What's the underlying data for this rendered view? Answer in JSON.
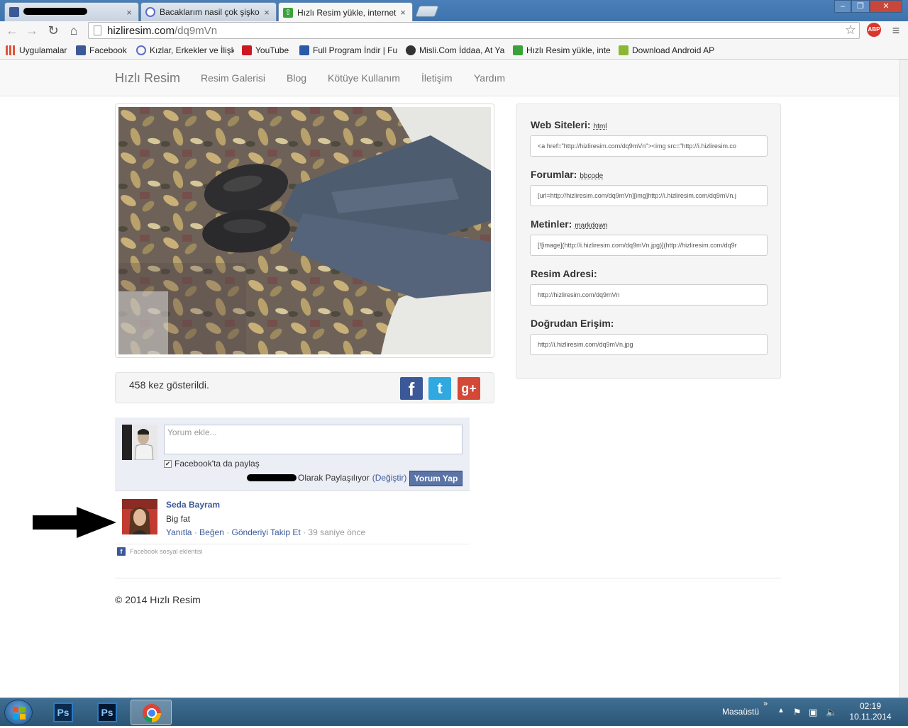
{
  "browser": {
    "tabs": [
      {
        "title": "",
        "active": false
      },
      {
        "title": "Bacaklarım nasil çok şişko",
        "active": false
      },
      {
        "title": "Hızlı Resim yükle, internet",
        "active": true
      }
    ],
    "tab_close": "×",
    "url_host": "hizliresim.com",
    "url_path": "/dq9mVn",
    "abp": "ABP",
    "window_controls": [
      "–",
      "❐",
      "✕"
    ],
    "bookmarks": [
      {
        "label": "Uygulamalar",
        "icon": "apps-grid-icon",
        "color": "#e0533a"
      },
      {
        "label": "Facebook",
        "icon": "facebook-icon",
        "color": "#3b5998"
      },
      {
        "label": "Kızlar, Erkekler ve İlişki",
        "icon": "swirl-icon",
        "color": "#5a6ccf"
      },
      {
        "label": "YouTube",
        "icon": "youtube-icon",
        "color": "#cc181e"
      },
      {
        "label": "Full Program İndir | Fu",
        "icon": "program-icon",
        "color": "#2b5aa8"
      },
      {
        "label": "Misli.Com İddaa, At Ya",
        "icon": "misli-icon",
        "color": "#333333"
      },
      {
        "label": "Hızlı Resim yükle, inter",
        "icon": "upload-arrow-icon",
        "color": "#3aa23a"
      },
      {
        "label": "Download Android AP",
        "icon": "android-icon",
        "color": "#8ab833"
      }
    ]
  },
  "site": {
    "brand": "Hızlı Resim",
    "nav": [
      "Resim Galerisi",
      "Blog",
      "Kötüye Kullanım",
      "İletişim",
      "Yardım"
    ],
    "views_text": "458 kez gösterildi.",
    "views_count": 458,
    "social": [
      {
        "name": "facebook",
        "glyph": "f",
        "color": "#3b5998"
      },
      {
        "name": "twitter",
        "glyph": "t",
        "color": "#2fa9e0"
      },
      {
        "name": "googleplus",
        "glyph": "g+",
        "color": "#d34836"
      }
    ],
    "embeds": [
      {
        "label": "Web Siteleri:",
        "sub": "html",
        "value": "<a href=\"http://hizliresim.com/dq9mVn\"><img src=\"http://i.hizliresim.co"
      },
      {
        "label": "Forumlar:",
        "sub": "bbcode",
        "value": "[url=http://hizliresim.com/dq9mVn][img]http://i.hizliresim.com/dq9mVn.j"
      },
      {
        "label": "Metinler:",
        "sub": "markdown",
        "value": "[![image](http://i.hizliresim.com/dq9mVn.jpg)](http://hizliresim.com/dq9r"
      },
      {
        "label": "Resim Adresi:",
        "sub": "",
        "value": "http://hizliresim.com/dq9mVn"
      },
      {
        "label": "Doğrudan Erişim:",
        "sub": "",
        "value": "http://i.hizliresim.com/dq9mVn.jpg"
      }
    ],
    "footer": "© 2014 Hızlı Resim"
  },
  "comments": {
    "placeholder": "Yorum ekle...",
    "share_fb_label": "Facebook'ta da paylaş",
    "share_fb_checked": true,
    "posting_as": "Olarak Paylaşılıyor",
    "change": "(Değiştir)",
    "post_button": "Yorum Yap",
    "entry": {
      "author": "Seda Bayram",
      "text": "Big fat",
      "reply": "Yanıtla",
      "like": "Beğen",
      "follow": "Gönderiyi Takip Et",
      "sep": "·",
      "time": "39 saniye önce"
    },
    "plugin_label": "Facebook sosyal eklentisi"
  },
  "taskbar": {
    "apps": [
      "Ps",
      "Ps"
    ],
    "desktop_label": "Masaüstü",
    "time": "02:19",
    "date": "10.11.2014"
  }
}
